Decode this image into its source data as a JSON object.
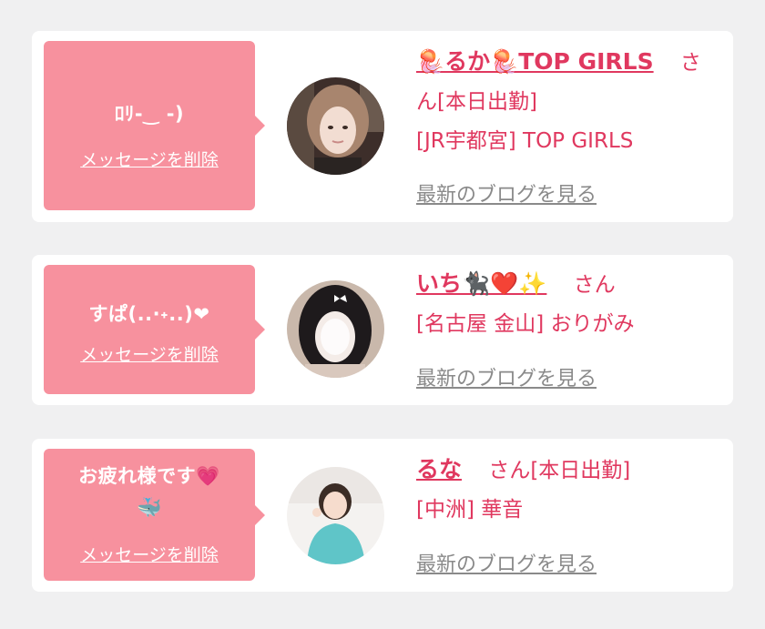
{
  "colors": {
    "background": "#f0f0f1",
    "card": "#ffffff",
    "bubble": "#f7919e",
    "accent_text": "#e0385f",
    "muted_link": "#8a8a8a"
  },
  "common": {
    "delete_label": "メッセージを削除",
    "blog_label": "最新のブログを見る",
    "honorific": "さん"
  },
  "cards": [
    {
      "message": "ﾛﾘ-‿ -)",
      "name": "🪼るか🪼TOP GIRLS",
      "status": "[本日出勤]",
      "shop": "[JR宇都宮] TOP GIRLS",
      "avatar_icon": "profile-photo"
    },
    {
      "message": "すぱ(..·˖..)❤",
      "name": "いち🐈‍⬛❤️✨",
      "status": "",
      "shop": "[名古屋 金山] おりがみ",
      "avatar_icon": "profile-photo"
    },
    {
      "message": "お疲れ様です💗",
      "message_line2": "🐳",
      "name": "るな",
      "status": "[本日出勤]",
      "shop": "[中洲] 華音",
      "avatar_icon": "profile-photo"
    }
  ]
}
